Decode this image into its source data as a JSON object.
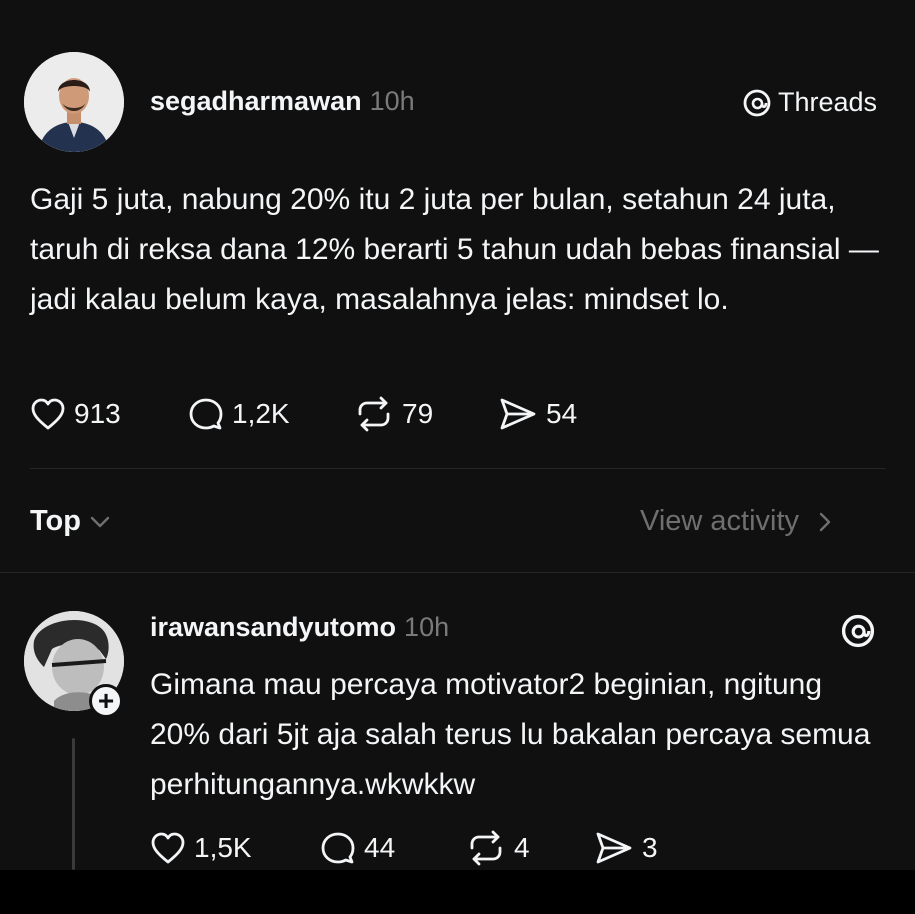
{
  "post": {
    "username": "segadharmawan",
    "time": "10h",
    "badge_label": "Threads",
    "text": "Gaji 5 juta, nabung 20% itu 2 juta per bulan, setahun 24 juta, taruh di reksa dana 12% berarti 5 tahun udah bebas finansial — jadi kalau belum kaya, masalahnya jelas: mindset lo.",
    "actions": {
      "likes": "913",
      "replies": "1,2K",
      "reposts": "79",
      "shares": "54"
    }
  },
  "replies_header": {
    "filter_label": "Top",
    "view_activity_label": "View activity"
  },
  "reply": {
    "username": "irawansandyutomo",
    "time": "10h",
    "text": "Gimana mau percaya motivator2 beginian, ngitung 20% dari 5jt aja salah terus lu bakalan percaya semua perhitungannya.wkwkkw",
    "follow_label": "+",
    "actions": {
      "likes": "1,5K",
      "replies": "44",
      "reposts": "4",
      "shares": "3"
    }
  }
}
